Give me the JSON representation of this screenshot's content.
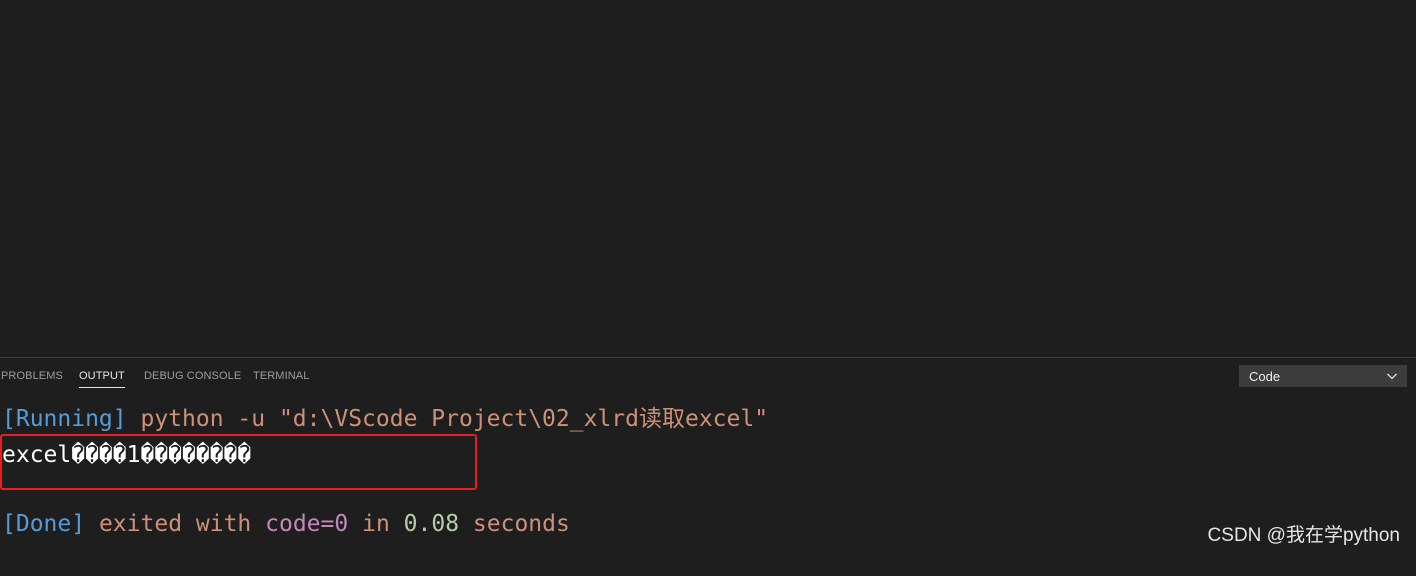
{
  "panel": {
    "tabs": [
      {
        "label": "PROBLEMS",
        "active": false
      },
      {
        "label": "OUTPUT",
        "active": true
      },
      {
        "label": "DEBUG CONSOLE",
        "active": false
      },
      {
        "label": "TERMINAL",
        "active": false
      }
    ],
    "channel_select": {
      "value": "Code",
      "icon": "chevron-down-icon"
    }
  },
  "output": {
    "running": {
      "tag": "[Running]",
      "command": "python -u \"d:\\VScode Project\\02_xlrd读取excel\""
    },
    "result_line": "excel����1��������",
    "done": {
      "tag": "[Done]",
      "text_exited": "exited with",
      "code_label": "code=",
      "code_value": "0",
      "text_in": "in",
      "duration": "0.08",
      "text_seconds": "seconds"
    }
  },
  "watermark": "CSDN @我在学python",
  "colors": {
    "background": "#1e1e1e",
    "keyword_blue": "#569cd6",
    "string_orange": "#ce9178",
    "purple": "#c586c0",
    "number_green": "#b5cea8",
    "highlight_red": "#e81f1f"
  }
}
